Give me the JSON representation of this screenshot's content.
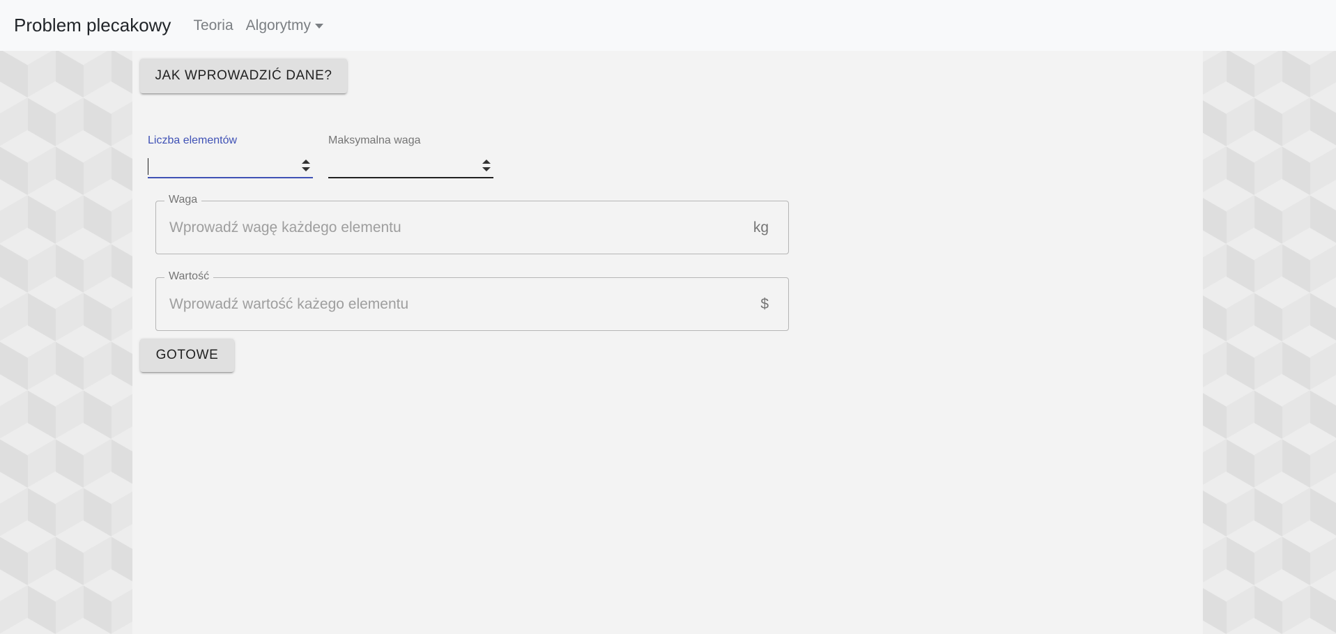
{
  "navbar": {
    "brand": "Problem plecakowy",
    "links": [
      {
        "label": "Teoria"
      },
      {
        "label": "Algorytmy"
      }
    ]
  },
  "main": {
    "help_button": "JAK WPROWADZIĆ DANE?",
    "fields": {
      "count_label": "Liczba elementów",
      "count_value": "",
      "max_weight_label": "Maksymalna waga",
      "max_weight_value": ""
    },
    "weight": {
      "label": "Waga",
      "placeholder": "Wprowadź wagę każdego elementu",
      "unit": "kg"
    },
    "value": {
      "label": "Wartość",
      "placeholder": "Wprowadź wartość każego elementu",
      "unit": "$"
    },
    "done_button": "GOTOWE"
  },
  "colors": {
    "accent": "#3f51b5",
    "navbar_bg": "#f8f9fa",
    "panel_bg": "#f3f3f3"
  }
}
